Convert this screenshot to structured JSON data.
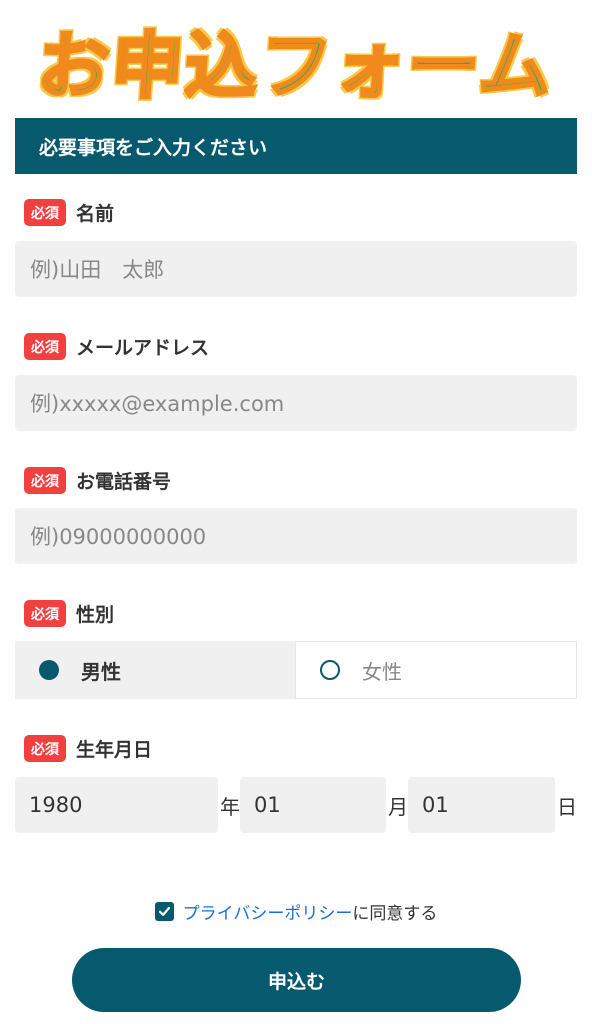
{
  "header": {
    "title": "お申込フォーム"
  },
  "section": {
    "title": "必要事項をご入力ください"
  },
  "required_badge": "必須",
  "fields": {
    "name": {
      "label": "名前",
      "placeholder": "例)山田　太郎"
    },
    "email": {
      "label": "メールアドレス",
      "placeholder": "例)xxxxx@example.com"
    },
    "phone": {
      "label": "お電話番号",
      "placeholder": "例)09000000000"
    },
    "gender": {
      "label": "性別",
      "options": [
        "男性",
        "女性"
      ],
      "selected": "男性"
    },
    "birthday": {
      "label": "生年月日",
      "year": "1980",
      "year_unit": "年",
      "month": "01",
      "month_unit": "月",
      "day": "01",
      "day_unit": "日"
    }
  },
  "agreement": {
    "checked": true,
    "link_text": "プライバシーポリシー",
    "suffix": "に同意する"
  },
  "submit": {
    "label": "申込む"
  },
  "colors": {
    "primary": "#075a6e",
    "required": "#f24040",
    "link": "#1a6fd8",
    "input_bg": "#f0f0f0"
  }
}
